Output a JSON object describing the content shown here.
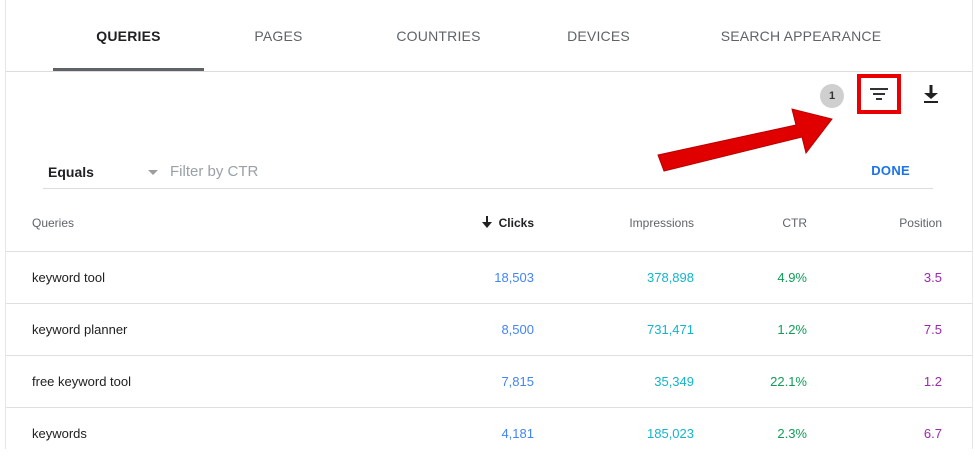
{
  "tabs": [
    {
      "label": "QUERIES",
      "active": true
    },
    {
      "label": "PAGES",
      "active": false
    },
    {
      "label": "COUNTRIES",
      "active": false
    },
    {
      "label": "DEVICES",
      "active": false
    },
    {
      "label": "SEARCH APPEARANCE",
      "active": false
    }
  ],
  "toolbar": {
    "filter_count": "1",
    "filter_icon": "filter-list-icon",
    "download_icon": "download-icon",
    "highlight_color": "#ea0000"
  },
  "filter": {
    "operator": "Equals",
    "placeholder": "Filter by CTR",
    "value": "",
    "done_label": "DONE"
  },
  "table": {
    "columns": {
      "query": "Queries",
      "clicks": "Clicks",
      "impressions": "Impressions",
      "ctr": "CTR",
      "position": "Position"
    },
    "sort_icon": "arrow-down-icon",
    "rows": [
      {
        "query": "keyword tool",
        "clicks": "18,503",
        "impressions": "378,898",
        "ctr": "4.9%",
        "position": "3.5"
      },
      {
        "query": "keyword planner",
        "clicks": "8,500",
        "impressions": "731,471",
        "ctr": "1.2%",
        "position": "7.5"
      },
      {
        "query": "free keyword tool",
        "clicks": "7,815",
        "impressions": "35,349",
        "ctr": "22.1%",
        "position": "1.2"
      },
      {
        "query": "keywords",
        "clicks": "4,181",
        "impressions": "185,023",
        "ctr": "2.3%",
        "position": "6.7"
      }
    ]
  },
  "colors": {
    "clicks": "#4285f4",
    "impressions": "#12b5cb",
    "ctr": "#0f9d58",
    "position": "#9c27b0",
    "accent": "#1a73e8",
    "annotation_arrow": "#e00000"
  }
}
